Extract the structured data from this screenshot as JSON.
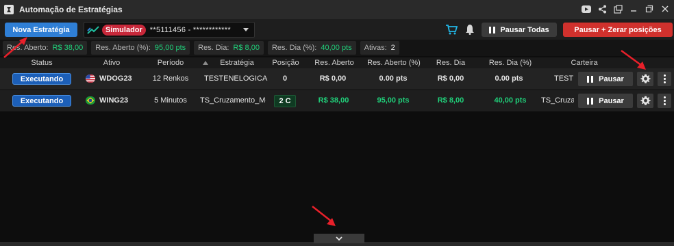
{
  "window": {
    "title": "Automação de Estratégias"
  },
  "toolbar": {
    "new_strategy_label": "Nova Estratégia",
    "account": {
      "mode_badge": "Simulador",
      "number": "**5111456 - ************"
    },
    "pause_all_label": "Pausar Todas",
    "pause_zero_label": "Pausar + Zerar posições"
  },
  "summary": [
    {
      "label": "Res. Aberto:",
      "value": "R$ 38,00"
    },
    {
      "label": "Res. Aberto (%):",
      "value": "95,00 pts"
    },
    {
      "label": "Res. Dia:",
      "value": "R$ 8,00"
    },
    {
      "label": "Res. Dia (%):",
      "value": "40,00 pts"
    },
    {
      "label": "Ativas:",
      "value": "2"
    }
  ],
  "table": {
    "headers": [
      "Status",
      "Ativo",
      "Período",
      "Estratégia",
      "Posição",
      "Res. Aberto",
      "Res. Aberto (%)",
      "Res. Dia",
      "Res. Dia (%)",
      "Carteira"
    ],
    "rows": [
      {
        "status": "Executando",
        "flag": "us-flag",
        "asset": "WDOG23",
        "period": "12 Renkos",
        "strategy": "TESTENELOGICA",
        "position": "0",
        "open_result": "R$ 0,00",
        "open_result_pct": "0.00 pts",
        "day_result": "R$ 0,00",
        "day_result_pct": "0.00 pts",
        "wallet": "TESTENELOGICA",
        "pause_label": "Pausar"
      },
      {
        "status": "Executando",
        "flag": "br-flag",
        "asset": "WING23",
        "period": "5 Minutos",
        "strategy": "TS_Cruzamento_Medias",
        "position": "2 C",
        "open_result": "R$ 38,00",
        "open_result_pct": "95,00 pts",
        "day_result": "R$ 8,00",
        "day_result_pct": "40,00 pts",
        "wallet": "TS_Cruzamento",
        "pause_label": "Pausar"
      }
    ]
  },
  "colors": {
    "primary": "#2f7fd6",
    "danger": "#d0312d",
    "positive": "#20d07a",
    "simulator_badge": "#c8283a"
  },
  "icons": [
    "app-logo-icon",
    "youtube-icon",
    "share-icon",
    "popout-icon",
    "minimize-icon",
    "maximize-icon",
    "close-icon",
    "cart-icon",
    "bell-icon",
    "gear-icon",
    "more-icon",
    "chevron-down-icon"
  ]
}
